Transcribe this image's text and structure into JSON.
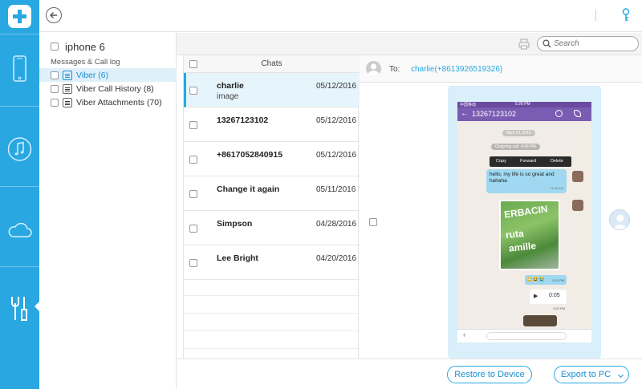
{
  "app": {
    "accent": "#29a7e1"
  },
  "rail": {
    "items": [
      {
        "icon": "phone-device-icon"
      },
      {
        "icon": "music-icon"
      },
      {
        "icon": "cloud-icon"
      },
      {
        "icon": "tools-icon",
        "active": true
      }
    ]
  },
  "tree": {
    "device_name": "iphone 6",
    "section_label": "Messages & Call log",
    "items": [
      {
        "label": "Viber (6)",
        "selected": true
      },
      {
        "label": "Viber Call History (8)",
        "selected": false
      },
      {
        "label": "Viber Attachments (70)",
        "selected": false
      }
    ]
  },
  "toolbar": {
    "search_placeholder": "Search"
  },
  "chatlist": {
    "header": "Chats",
    "rows": [
      {
        "name": "charlie",
        "sub": "image",
        "date": "05/12/2016",
        "selected": true
      },
      {
        "name": "13267123102",
        "sub": "",
        "date": "05/12/2016",
        "selected": false
      },
      {
        "name": "+8617052840915",
        "sub": "",
        "date": "05/12/2016",
        "selected": false
      },
      {
        "name": "Change it again",
        "sub": "",
        "date": "05/11/2016",
        "selected": false
      },
      {
        "name": "Simpson",
        "sub": "",
        "date": "04/28/2016",
        "selected": false
      },
      {
        "name": "Lee Bright",
        "sub": "",
        "date": "04/20/2016",
        "selected": false
      }
    ]
  },
  "detail": {
    "to_label": "To:",
    "to_value": "charlie(+8613926519326)",
    "phone": {
      "carrier": "中国移动",
      "time": "5:26 PM",
      "title": "13267123102",
      "date_pill": "April 19, 2016",
      "outgoing_call": "Outgoing call",
      "outgoing_time": "4:43 PM",
      "menu": [
        "Copy",
        "Forward",
        "Delete"
      ],
      "message": "hello, my life is so great and hahaha",
      "message_time": "11:08 AM",
      "image_text": [
        "ERBACIN",
        "ruta",
        "amille"
      ],
      "emoji_time": "2:02 PM",
      "audio_duration": "0:05",
      "audio_time": "2:02 PM"
    }
  },
  "bottombar": {
    "restore_label": "Restore to Device",
    "export_label": "Export to PC"
  }
}
